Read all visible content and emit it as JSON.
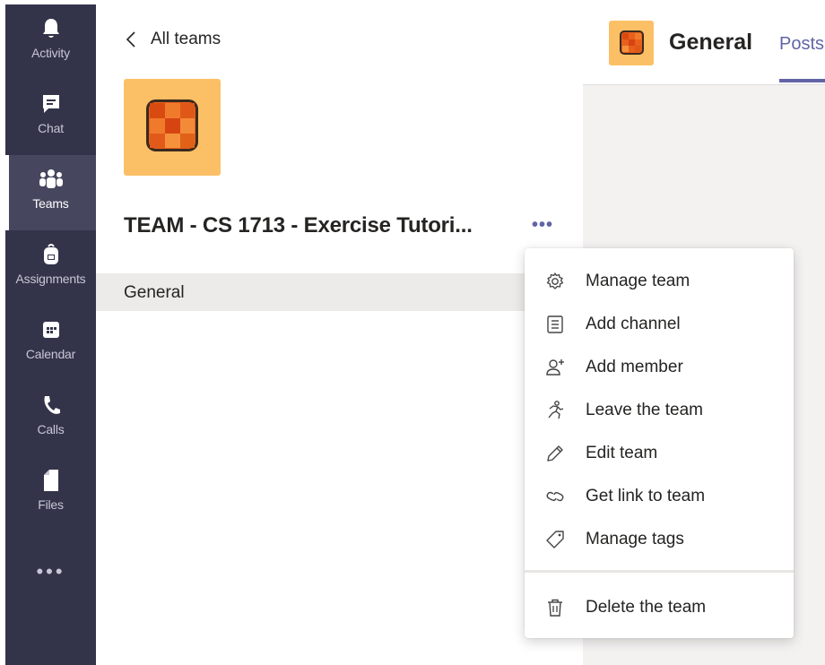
{
  "rail": {
    "items": [
      {
        "label": "Activity",
        "icon": "bell-icon"
      },
      {
        "label": "Chat",
        "icon": "chat-icon"
      },
      {
        "label": "Teams",
        "icon": "teams-icon",
        "active": true
      },
      {
        "label": "Assignments",
        "icon": "backpack-icon"
      },
      {
        "label": "Calendar",
        "icon": "calendar-icon"
      },
      {
        "label": "Calls",
        "icon": "phone-icon"
      },
      {
        "label": "Files",
        "icon": "file-icon"
      }
    ],
    "more": "•••"
  },
  "panel": {
    "back_label": "All teams",
    "team_name": "TEAM - CS 1713 - Exercise Tutori...",
    "more_label": "•••",
    "channel": "General"
  },
  "main": {
    "title": "General",
    "tab": "Posts"
  },
  "menu": {
    "items": [
      {
        "label": "Manage team",
        "icon": "gear-icon"
      },
      {
        "label": "Add channel",
        "icon": "channel-list-icon"
      },
      {
        "label": "Add member",
        "icon": "add-person-icon"
      },
      {
        "label": "Leave the team",
        "icon": "running-person-icon"
      },
      {
        "label": "Edit team",
        "icon": "pencil-icon"
      },
      {
        "label": "Get link to team",
        "icon": "link-icon"
      },
      {
        "label": "Manage tags",
        "icon": "tag-icon"
      }
    ],
    "delete": {
      "label": "Delete the team",
      "icon": "trash-icon"
    }
  },
  "colors": {
    "rail_bg": "#33344a",
    "rail_active": "#46475f",
    "accent": "#6264a7",
    "team_avatar_bg": "#fbc066",
    "tile_orange": "#e8601c"
  }
}
